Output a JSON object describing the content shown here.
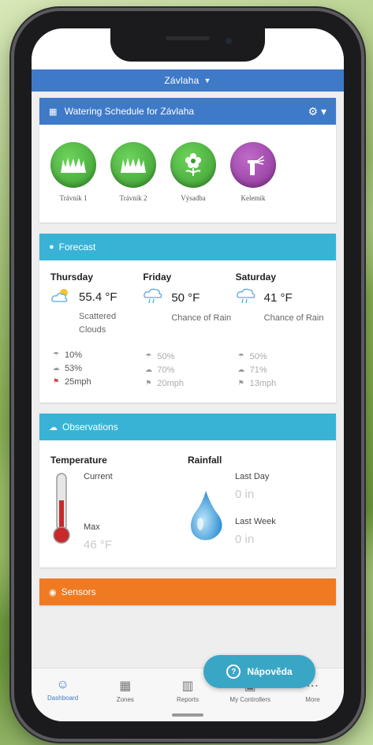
{
  "topbar": {
    "title": "Závlaha"
  },
  "schedule": {
    "title": "Watering Schedule for Závlaha",
    "zones": [
      {
        "label": "Trávník 1",
        "icon": "grass-icon",
        "color": "#4caf3a"
      },
      {
        "label": "Trávník 2",
        "icon": "grass-icon",
        "color": "#4caf3a"
      },
      {
        "label": "Výsadba",
        "icon": "flower-icon",
        "color": "#4caf3a"
      },
      {
        "label": "Kelemik",
        "icon": "sprinkler-icon",
        "color": "#9c3fa8"
      }
    ]
  },
  "forecast": {
    "title": "Forecast",
    "days": [
      {
        "name": "Thursday",
        "temp": "55.4 °F",
        "condition": "Scattered Clouds",
        "precip": "10%",
        "humidity": "53%",
        "wind": "25mph",
        "icon": "partly-cloudy-icon"
      },
      {
        "name": "Friday",
        "temp": "50 °F",
        "condition": "Chance of Rain",
        "precip": "50%",
        "humidity": "70%",
        "wind": "20mph",
        "icon": "rain-cloud-icon"
      },
      {
        "name": "Saturday",
        "temp": "41 °F",
        "condition": "Chance of Rain",
        "precip": "50%",
        "humidity": "71%",
        "wind": "13mph",
        "icon": "rain-cloud-icon"
      }
    ]
  },
  "observations": {
    "title": "Observations",
    "temperature": {
      "title": "Temperature",
      "current_label": "Current",
      "max_label": "Max",
      "max_value": "46 °F"
    },
    "rainfall": {
      "title": "Rainfall",
      "last_day_label": "Last Day",
      "last_day_value": "0 in",
      "last_week_label": "Last Week",
      "last_week_value": "0 in"
    }
  },
  "sensors": {
    "title": "Sensors"
  },
  "bottom_nav": [
    {
      "label": "Dashboard",
      "icon": "smiley-icon",
      "active": true
    },
    {
      "label": "Zones",
      "icon": "grid-icon"
    },
    {
      "label": "Reports",
      "icon": "bar-chart-icon"
    },
    {
      "label": "My Controllers",
      "icon": "controller-icon"
    },
    {
      "label": "More",
      "icon": "more-icon"
    }
  ],
  "help_button": {
    "label": "Nápověda"
  },
  "colors": {
    "header_blue": "#3f7ac8",
    "header_cyan": "#38b3d6",
    "header_orange": "#f07a22",
    "help": "#3aa6c6"
  }
}
